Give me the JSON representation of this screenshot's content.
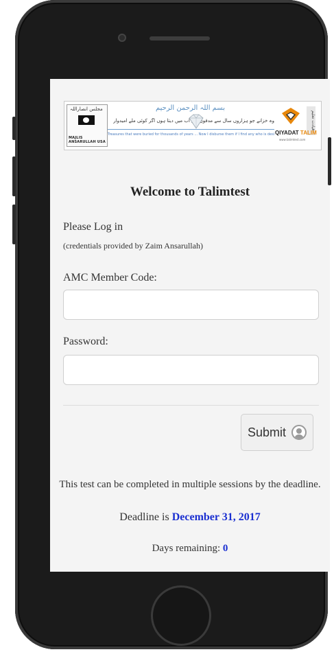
{
  "banner": {
    "left_logo_top_text": "مجلس انصاراللہ",
    "left_logo_caption": "MAJLIS ANSARULLAH USA",
    "bismillah": "بسم اللہ الرحمن الرحیم",
    "urdu_line": "وہ خزانے جو ہزاروں سال سے مدفون تھے اب میں دیتا ہوں اگر کوئی ملے امیدوار",
    "english_line": "Treasures that were buried for thousands of years ... Now I disburse them if I find any who is desirous. (Izaala Auhaam)",
    "right_logo_name_a": "QIYADAT",
    "right_logo_name_b": "TALIM",
    "right_logo_site": "www.talimtest.com",
    "right_logo_vertical": "قیادت تعلیم"
  },
  "page": {
    "title": "Welcome to Talimtest",
    "please_login": "Please Log in",
    "credentials_note": "(credentials provided by Zaim Ansarullah)"
  },
  "form": {
    "member_code_label": "AMC Member Code:",
    "member_code_value": "",
    "password_label": "Password:",
    "password_value": "",
    "submit_label": "Submit"
  },
  "info": {
    "sessions_note": "This test can be completed in multiple sessions by the deadline.",
    "deadline_prefix": "Deadline is ",
    "deadline_date": "December 31, 2017",
    "days_prefix": "Days remaining: ",
    "days_value": "0"
  },
  "colors": {
    "accent_blue": "#1a2fd1",
    "brand_orange": "#e8880c"
  }
}
